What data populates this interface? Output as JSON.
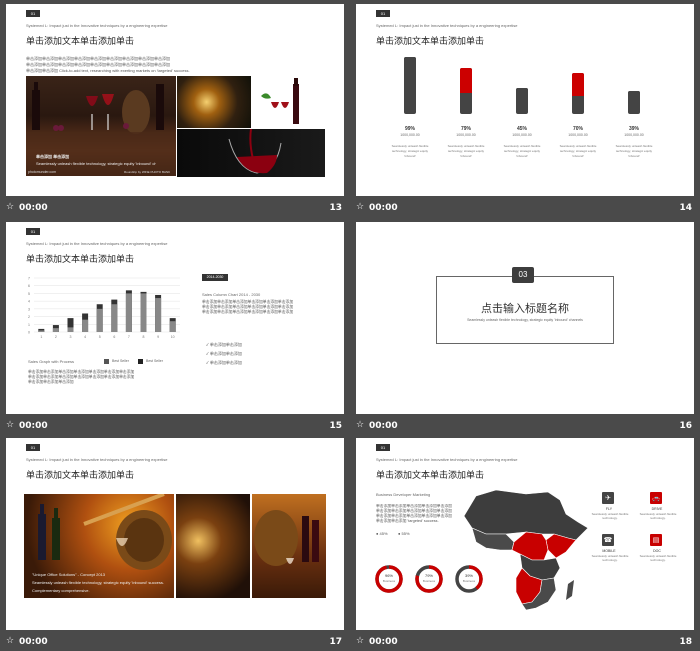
{
  "common": {
    "tag": "01",
    "subtitle": "Systemed L: Impact just in the Innovative techniques by a engineering expertise",
    "title": "单击添加文本单击添加单击",
    "time": "00:00",
    "star_icon": "star-icon"
  },
  "s13": {
    "number": "13",
    "body": [
      "单击添加单击添加单击添加单击添加单击添加单击添加单击添加单击添加单击添加",
      "单击添加单击添加单击添加单击添加单击添加单击添加单击添加单击添加单击添加",
      "单击添加单击添加 Click-to-add text, researching with exerting markets on 'targeted' success."
    ],
    "photo_caption": "单击添加 单击添加",
    "photo_caption2": "Seamlessly unleash flexible technology, strategic equity 'inbound' channels on 'targeted' success.",
    "credits_left": "photomunder.com",
    "credits_right": "Roundtrip by WINE PHOTO BANK"
  },
  "s14": {
    "number": "14",
    "bars": [
      {
        "percent": "99%",
        "value": "1000,000.00",
        "level": 0.99,
        "color": "#e00000",
        "dark_color": "#444444"
      },
      {
        "percent": "79%",
        "value": "1000,000.00",
        "level": 0.79,
        "color": "#cc0000",
        "dark_color": "#444444"
      },
      {
        "percent": "45%",
        "value": "1000,000.00",
        "level": 0.45,
        "color": "#e00000",
        "dark_color": "#444444"
      },
      {
        "percent": "70%",
        "value": "1000,000.00",
        "level": 0.7,
        "color": "#cc0000",
        "dark_color": "#444444"
      },
      {
        "percent": "39%",
        "value": "1000,000.00",
        "level": 0.39,
        "color": "#e00000",
        "dark_color": "#444444"
      }
    ],
    "bar_caption1": "Seamlessly unleash flexible",
    "bar_caption2": "technology, strategic equity",
    "bar_caption3": "'inbound'"
  },
  "s15": {
    "number": "15",
    "legend_title": "Sales Graph with Process",
    "legend_a": "Best Seller",
    "legend_b": "Best Seller",
    "right_tag": "2014-2030",
    "right_heading": "Sales Column Chart 2014 - 2030",
    "right_body": [
      "单击添加单击添加单击添加单击添加单击添加单击添加",
      "单击添加单击添加单击添加单击添加单击添加单击添加",
      "单击添加单击添加单击添加单击添加单击添加单击添加"
    ],
    "checks": [
      "单击添加单击添加",
      "单击添加单击添加",
      "单击添加单击添加"
    ],
    "bottom_body": [
      "单击添加单击添加单击添加单击添加单击添加单击添加单击添加",
      "单击添加单击添加单击添加单击添加单击添加单击添加单击添加",
      "单击添加单击添加单击添加"
    ]
  },
  "s16": {
    "number": "16",
    "section": "03",
    "heading": "点击输入标题名称",
    "sub": "Seamlessly unleash flexible technology, strategic equity 'inbound' channels"
  },
  "s17": {
    "number": "17",
    "caption1": "\"Unique Office Solutions\" - Concept 2013",
    "caption2": "Seamlessly unleash flexible technology, strategic equity 'inbound' success.",
    "caption3": "Complementary comprehensive."
  },
  "s18": {
    "number": "18",
    "heading": "Business Developer Marketing",
    "body": [
      "单击添加单击添加单击添加单击添加单击添加",
      "单击添加单击添加单击添加单击添加单击添加",
      "单击添加单击添加单击添加单击添加单击添加",
      "单击添加单击添加 'targeted' success."
    ],
    "chips": [
      "45%",
      "55%"
    ],
    "rings": [
      {
        "label": "96%",
        "sub": "Business",
        "level": 0.96
      },
      {
        "label": "79%",
        "sub": "Business",
        "level": 0.79
      },
      {
        "label": "39%",
        "sub": "Business",
        "level": 0.39
      }
    ],
    "icons": [
      {
        "name": "airplane-icon",
        "label": "FLY",
        "desc": "Seamlessly unleash flexible technology."
      },
      {
        "name": "car-icon",
        "label": "DRIVE",
        "desc": "Seamlessly unleash flexible technology."
      },
      {
        "name": "phone-icon",
        "label": "MOBILE",
        "desc": "Seamlessly unleash flexible technology."
      },
      {
        "name": "document-icon",
        "label": "DOC",
        "desc": "Seamlessly unleash flexible technology."
      }
    ]
  },
  "chart_data": {
    "type": "bar",
    "categories": [
      "1",
      "2",
      "3",
      "4",
      "5",
      "6",
      "7",
      "8",
      "9",
      "10"
    ],
    "series": [
      {
        "name": "Best Seller",
        "values": [
          0.2,
          0.5,
          0.6,
          1.6,
          3,
          3.6,
          5,
          5,
          4.4,
          1.4
        ]
      },
      {
        "name": "Best Seller",
        "values": [
          0.4,
          0.9,
          1.8,
          2.4,
          3.6,
          4.2,
          5.4,
          5.2,
          4.8,
          1.8
        ]
      }
    ],
    "yticks": [
      "0",
      "1",
      "2",
      "3",
      "4",
      "5",
      "6",
      "7"
    ],
    "ylim": [
      0,
      7
    ]
  }
}
